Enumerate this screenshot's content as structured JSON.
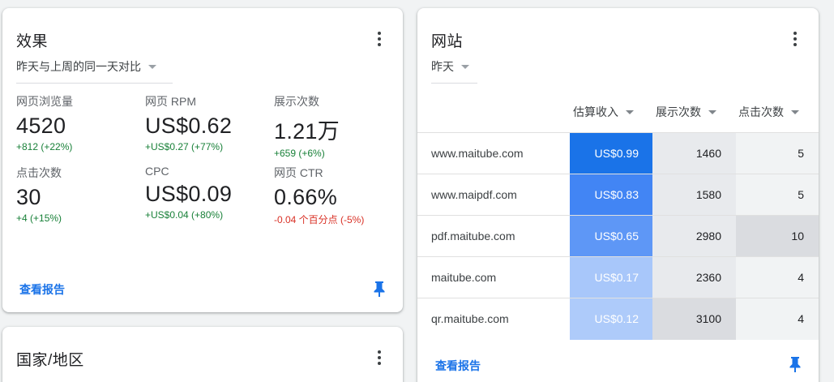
{
  "performance": {
    "title": "效果",
    "comparison": "昨天与上周的同一天对比",
    "metrics": [
      {
        "label": "网页浏览量",
        "value": "4520",
        "delta": "+812 (+22%)",
        "trend": "up"
      },
      {
        "label": "网页 RPM",
        "value": "US$0.62",
        "delta": "+US$0.27 (+77%)",
        "trend": "up"
      },
      {
        "label": "展示次数",
        "value": "1.21万",
        "delta": "+659 (+6%)",
        "trend": "up"
      },
      {
        "label": "点击次数",
        "value": "30",
        "delta": "+4 (+15%)",
        "trend": "up"
      },
      {
        "label": "CPC",
        "value": "US$0.09",
        "delta": "+US$0.04 (+80%)",
        "trend": "up"
      },
      {
        "label": "网页 CTR",
        "value": "0.66%",
        "delta": "-0.04 个百分点 (-5%)",
        "trend": "down"
      }
    ],
    "view_report": "查看报告"
  },
  "sites": {
    "title": "网站",
    "period": "昨天",
    "columns": [
      "估算收入",
      "展示次数",
      "点击次数"
    ],
    "rows": [
      {
        "site": "www.maitube.com",
        "revenue": "US$0.99",
        "impressions": "1460",
        "clicks": "5",
        "rev_bg": "#1a73e8",
        "imp_bg": "#e8eaed",
        "clk_bg": "#f1f3f4"
      },
      {
        "site": "www.maipdf.com",
        "revenue": "US$0.83",
        "impressions": "1580",
        "clicks": "5",
        "rev_bg": "#4285f4",
        "imp_bg": "#e8eaed",
        "clk_bg": "#f1f3f4"
      },
      {
        "site": "pdf.maitube.com",
        "revenue": "US$0.65",
        "impressions": "2980",
        "clicks": "10",
        "rev_bg": "#5e97f6",
        "imp_bg": "#e8eaed",
        "clk_bg": "#dadce0"
      },
      {
        "site": "maitube.com",
        "revenue": "US$0.17",
        "impressions": "2360",
        "clicks": "4",
        "rev_bg": "#a8c7fa",
        "imp_bg": "#e8eaed",
        "clk_bg": "#f1f3f4"
      },
      {
        "site": "qr.maitube.com",
        "revenue": "US$0.12",
        "impressions": "3100",
        "clicks": "4",
        "rev_bg": "#aecbfa",
        "imp_bg": "#dadce0",
        "clk_bg": "#f1f3f4"
      }
    ],
    "view_report": "查看报告"
  },
  "geo": {
    "title": "国家/地区"
  },
  "colors": {
    "accent": "#1a73e8",
    "positive": "#188038",
    "negative": "#d93025"
  }
}
